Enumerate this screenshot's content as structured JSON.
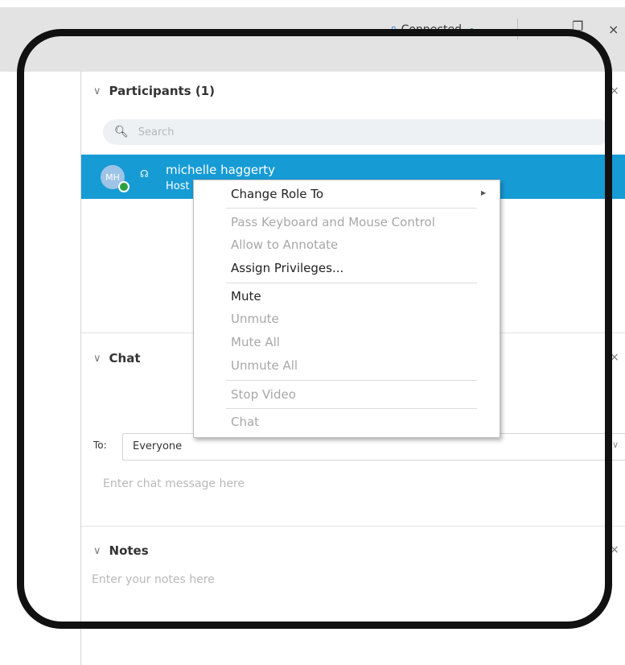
{
  "titlebar": {
    "status": "Connected",
    "minimize_glyph": "—",
    "restore_glyph": "❐",
    "close_glyph": "×"
  },
  "participants": {
    "header": "Participants (1)",
    "close_glyph": "×",
    "search_placeholder": "Search",
    "items": [
      {
        "initials": "MH",
        "name": "michelle haggerty",
        "role": "Host"
      }
    ]
  },
  "context_menu": {
    "items": [
      {
        "label": "Change Role To",
        "enabled": true,
        "submenu": true
      },
      {
        "label": "Pass Keyboard and Mouse Control",
        "enabled": false
      },
      {
        "label": "Allow to Annotate",
        "enabled": false
      },
      {
        "label": "Assign Privileges...",
        "enabled": true
      },
      {
        "label": "Mute",
        "enabled": true
      },
      {
        "label": "Unmute",
        "enabled": false
      },
      {
        "label": "Mute All",
        "enabled": false
      },
      {
        "label": "Unmute All",
        "enabled": false
      },
      {
        "label": "Stop Video",
        "enabled": false
      },
      {
        "label": "Chat",
        "enabled": false
      }
    ]
  },
  "chat": {
    "header": "Chat",
    "close_glyph": "×",
    "to_label": "To:",
    "to_value": "Everyone",
    "message_placeholder": "Enter chat message here"
  },
  "notes": {
    "header": "Notes",
    "close_glyph": "×",
    "placeholder": "Enter your notes here"
  },
  "colors": {
    "selected_row": "#169bd5",
    "status_green": "#3aa14a",
    "frame": "#111111"
  }
}
